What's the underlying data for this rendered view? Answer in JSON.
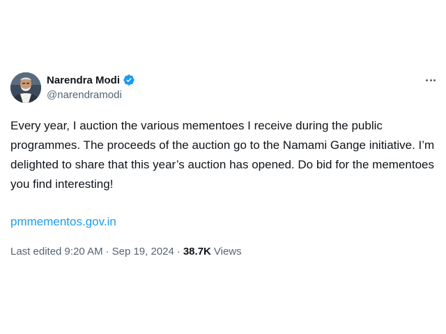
{
  "tweet": {
    "author": {
      "name": "Narendra Modi",
      "handle": "@narendramodi",
      "verified": true,
      "verified_color": "#1d9bf0"
    },
    "more_icon": "more-horizontal-icon",
    "text": "Every year, I auction the various mementoes I receive during the public programmes. The proceeds of the auction go to the Namami Gange initiative. I’m delighted to share that this year’s auction has opened. Do bid for the mementoes you find interesting!",
    "link": "pmmementos.gov.in",
    "meta": {
      "edited": "Last edited 9:20 AM",
      "separator": "·",
      "date": "Sep 19, 2024",
      "views_count": "38.7K",
      "views_label": "Views"
    }
  },
  "colors": {
    "text": "#0f1419",
    "secondary": "#536471",
    "link": "#1d9bf0"
  }
}
